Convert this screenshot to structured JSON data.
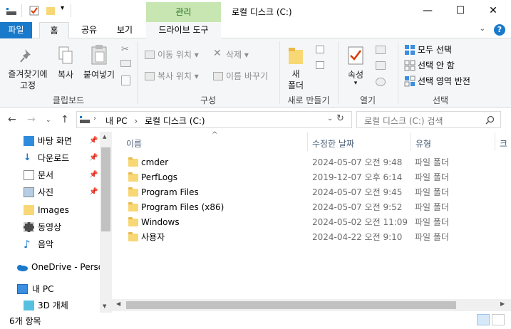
{
  "window": {
    "context_tab_header": "관리",
    "title": "로컬 디스크 (C:)",
    "minimize_glyph": "—",
    "maximize_glyph": "☐",
    "close_glyph": "✕"
  },
  "ribbon_tabs": {
    "file": "파일",
    "home": "홈",
    "share": "공유",
    "view": "보기",
    "drive_tools": "드라이브 도구"
  },
  "ribbon": {
    "clipboard": {
      "pin_quick": "즐겨찾기에\n고정",
      "copy": "복사",
      "paste": "붙여넣기",
      "label": "클립보드"
    },
    "organize": {
      "move_to": "이동 위치",
      "copy_to": "복사 위치",
      "delete": "삭제",
      "rename": "이름 바꾸기",
      "label": "구성"
    },
    "new": {
      "new_folder": "새\n폴더",
      "label": "새로 만들기"
    },
    "open": {
      "properties": "속성",
      "label": "열기"
    },
    "select": {
      "select_all": "모두 선택",
      "select_none": "선택 안 함",
      "invert": "선택 영역 반전",
      "label": "선택"
    }
  },
  "nav": {
    "path_root": "내 PC",
    "path_current": "로컬 디스크 (C:)",
    "search_placeholder": "로컬 디스크 (C:) 검색"
  },
  "nav_pane": [
    {
      "label": "바탕 화면",
      "icon": "desktop-icon",
      "pinned": true
    },
    {
      "label": "다운로드",
      "icon": "download-icon",
      "pinned": true
    },
    {
      "label": "문서",
      "icon": "document-icon",
      "pinned": true
    },
    {
      "label": "사진",
      "icon": "pictures-icon",
      "pinned": true
    },
    {
      "label": "Images",
      "icon": "folder-icon",
      "pinned": false
    },
    {
      "label": "동영상",
      "icon": "video-icon",
      "pinned": false
    },
    {
      "label": "음악",
      "icon": "music-icon",
      "pinned": false
    },
    {
      "label": "OneDrive - Person",
      "icon": "onedrive-icon",
      "pinned": false
    },
    {
      "label": "내 PC",
      "icon": "pc-icon",
      "pinned": false
    },
    {
      "label": "3D 개체",
      "icon": "3d-objects-icon",
      "pinned": false
    }
  ],
  "columns": {
    "name": "이름",
    "modified": "수정한 날짜",
    "type": "유형",
    "size": "크"
  },
  "files": [
    {
      "name": "cmder",
      "modified": "2024-05-07 오전 9:48",
      "type": "파일 폴더"
    },
    {
      "name": "PerfLogs",
      "modified": "2019-12-07 오후 6:14",
      "type": "파일 폴더"
    },
    {
      "name": "Program Files",
      "modified": "2024-05-07 오전 9:45",
      "type": "파일 폴더"
    },
    {
      "name": "Program Files (x86)",
      "modified": "2024-05-07 오전 9:52",
      "type": "파일 폴더"
    },
    {
      "name": "Windows",
      "modified": "2024-05-02 오전 11:09",
      "type": "파일 폴더"
    },
    {
      "name": "사용자",
      "modified": "2024-04-22 오전 9:10",
      "type": "파일 폴더"
    }
  ],
  "status": {
    "item_count": "6개 항목"
  },
  "colors": {
    "file_tab": "#1979ca",
    "context_tab": "#c7e6b1",
    "folder": "#f8d775"
  }
}
